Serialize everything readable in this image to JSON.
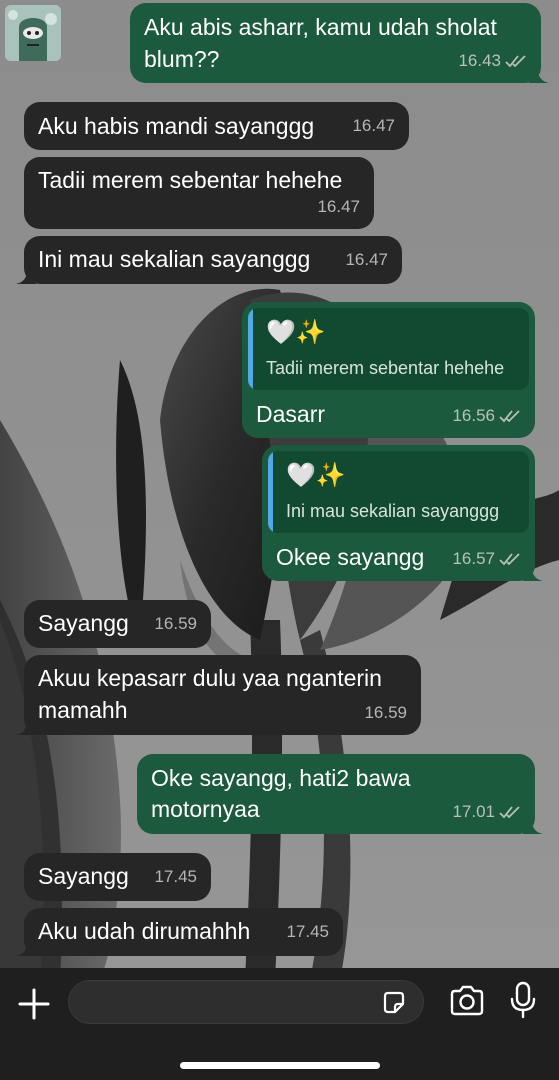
{
  "chat": {
    "messages": [
      {
        "dir": "out",
        "text_lines": [
          "Aku abis asharr, kamu udah sholat",
          "blum??"
        ],
        "time": "16.43",
        "read": true
      },
      {
        "dir": "in",
        "text_lines": [
          "Aku habis mandi sayanggg"
        ],
        "time": "16.47"
      },
      {
        "dir": "in",
        "text_lines": [
          "Tadii merem sebentar hehehe"
        ],
        "time": "16.47"
      },
      {
        "dir": "in",
        "text_lines": [
          "Ini mau sekalian sayanggg"
        ],
        "time": "16.47"
      },
      {
        "dir": "out",
        "quote": {
          "emoji": "🤍✨",
          "text": "Tadii merem sebentar hehehe"
        },
        "text_lines": [
          "Dasarr"
        ],
        "time": "16.56",
        "read": true
      },
      {
        "dir": "out",
        "quote": {
          "emoji": "🤍✨",
          "text": "Ini mau sekalian sayanggg"
        },
        "text_lines": [
          "Okee sayangg"
        ],
        "time": "16.57",
        "read": true
      },
      {
        "dir": "in",
        "text_lines": [
          "Sayangg"
        ],
        "time": "16.59"
      },
      {
        "dir": "in",
        "text_lines": [
          "Akuu kepasarr dulu yaa nganterin",
          "mamahh"
        ],
        "time": "16.59"
      },
      {
        "dir": "out",
        "text_lines": [
          "Oke sayangg, hati2 bawa",
          "motornyaa"
        ],
        "time": "17.01",
        "read": true
      },
      {
        "dir": "in",
        "text_lines": [
          "Sayangg"
        ],
        "time": "17.45"
      },
      {
        "dir": "in",
        "text_lines": [
          "Aku udah dirumahhh"
        ],
        "time": "17.45"
      }
    ]
  },
  "composer": {
    "input_value": "",
    "icons": {
      "add": "plus-icon",
      "sticker": "sticker-icon",
      "camera": "camera-icon",
      "mic": "microphone-icon"
    }
  },
  "colors": {
    "incoming_bubble": "#262626",
    "outgoing_bubble": "#1b5a3c",
    "quote_bar": "#53a8e6",
    "bottom_bar": "#1f1f1f"
  }
}
